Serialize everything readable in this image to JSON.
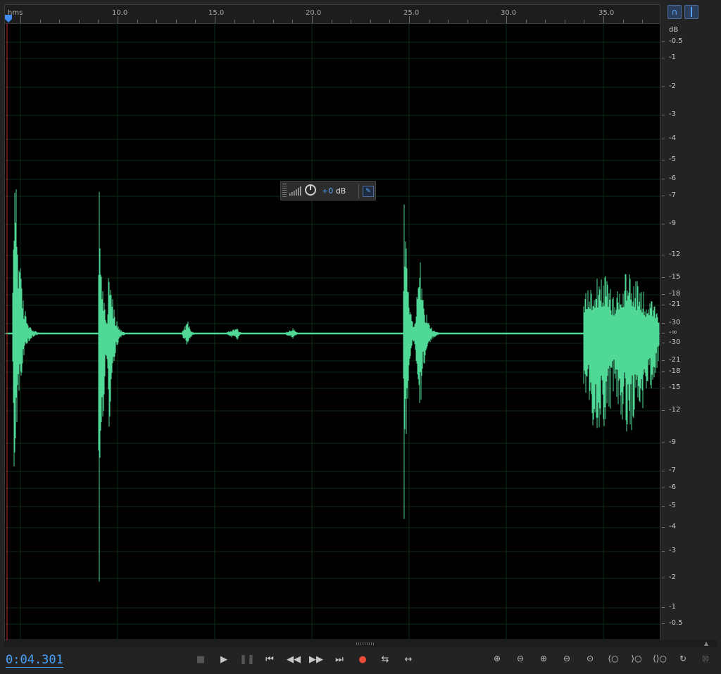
{
  "ruler": {
    "unit": "hms",
    "labels": [
      "10.0",
      "15.0",
      "20.0",
      "25.0",
      "30.0",
      "35.0"
    ]
  },
  "db_scale": {
    "unit": "dB",
    "labels_top": [
      "-0.5",
      "-1",
      "-2",
      "-3",
      "-4",
      "-5",
      "-6",
      "-7",
      "-9",
      "-12",
      "-15",
      "-18",
      "-21",
      "-30"
    ],
    "center": "-∞",
    "labels_bottom": [
      "-30",
      "-21",
      "-18",
      "-15",
      "-12",
      "-9",
      "-7",
      "-6",
      "-5",
      "-4",
      "-3",
      "-2",
      "-1",
      "-0.5"
    ]
  },
  "hud": {
    "value_num": "+0",
    "value_unit": " dB"
  },
  "time_display": "0:04.301",
  "colors": {
    "waveform": "#4fd896",
    "background": "#000000",
    "accent": "#4aa4ff",
    "record": "#e84b3a"
  },
  "transport": [
    {
      "name": "stop-button",
      "icon": "stop-icon"
    },
    {
      "name": "play-button",
      "icon": "play-icon"
    },
    {
      "name": "pause-button",
      "icon": "pause-icon"
    },
    {
      "name": "go-to-start-button",
      "icon": "skip-back-icon"
    },
    {
      "name": "rewind-button",
      "icon": "rewind-icon"
    },
    {
      "name": "fast-forward-button",
      "icon": "fast-forward-icon"
    },
    {
      "name": "go-to-end-button",
      "icon": "skip-forward-icon"
    },
    {
      "name": "record-button",
      "icon": "record-icon"
    },
    {
      "name": "loop-button",
      "icon": "loop-icon"
    },
    {
      "name": "skip-selection-button",
      "icon": "skip-selection-icon"
    }
  ],
  "zoom_tools": [
    {
      "name": "zoom-in-amplitude-button",
      "icon": "zoom-in-amplitude-icon"
    },
    {
      "name": "zoom-out-amplitude-button",
      "icon": "zoom-out-amplitude-icon"
    },
    {
      "name": "zoom-in-time-button",
      "icon": "zoom-in-time-icon"
    },
    {
      "name": "zoom-out-time-button",
      "icon": "zoom-out-time-icon"
    },
    {
      "name": "zoom-out-full-button",
      "icon": "zoom-full-icon"
    },
    {
      "name": "zoom-in-at-in-point-button",
      "icon": "zoom-in-point-icon"
    },
    {
      "name": "zoom-in-at-out-point-button",
      "icon": "zoom-out-point-icon"
    },
    {
      "name": "zoom-to-selection-button",
      "icon": "zoom-selection-icon"
    },
    {
      "name": "zoom-reset-button",
      "icon": "zoom-reset-icon"
    },
    {
      "name": "zoom-to-clip-button",
      "icon": "zoom-clip-icon"
    }
  ]
}
